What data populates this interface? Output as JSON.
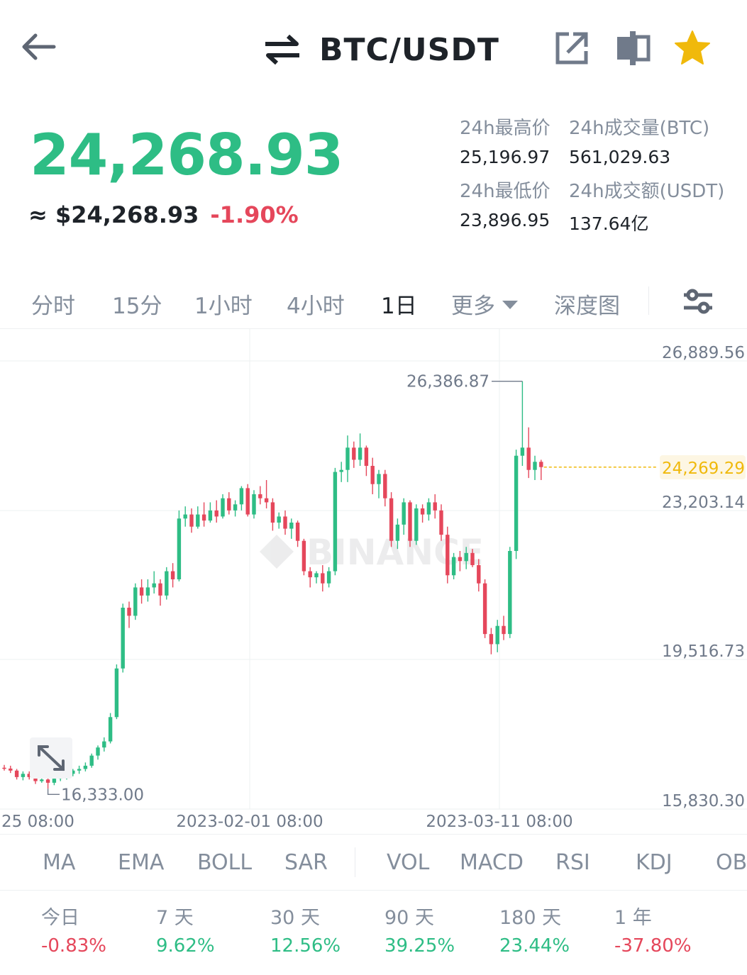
{
  "header": {
    "pair": "BTC/USDT",
    "icons": [
      "arrow-left-icon",
      "swap-icon",
      "external-link-icon",
      "compare-icon",
      "star-icon"
    ]
  },
  "price": {
    "last": "24,268.93",
    "usd": "≈ $24,268.93",
    "change": "-1.90%"
  },
  "stats": {
    "high_label": "24h最高价",
    "high_value": "25,196.97",
    "low_label": "24h最低价",
    "low_value": "23,896.95",
    "vol_label": "24h成交量(BTC)",
    "vol_value": "561,029.63",
    "turnover_label": "24h成交额(USDT)",
    "turnover_value": "137.64亿"
  },
  "timeframes": {
    "items": [
      "分时",
      "15分",
      "1小时",
      "4小时",
      "1日",
      "更多",
      "深度图"
    ],
    "active": "1日"
  },
  "chart": {
    "price_labels": [
      "26,889.56",
      "24,269.29",
      "23,203.14",
      "19,516.73",
      "15,830.30"
    ],
    "high_marker": "26,386.87",
    "low_marker": "16,333.00",
    "date_labels": [
      "25 08:00",
      "2023-02-01 08:00",
      "2023-03-11 08:00"
    ],
    "watermark": "BINANCE",
    "colors": {
      "up": "#2ebd85",
      "down": "#e5475b",
      "current": "#f0b90b"
    }
  },
  "chart_data": {
    "type": "candlestick",
    "x_start": "2022-12-25",
    "y_range": [
      15830.3,
      26889.56
    ],
    "current_price": 24269.29,
    "high": 26386.87,
    "low": 16333.0,
    "ohlc": [
      [
        16850,
        16920,
        16780,
        16830
      ],
      [
        16830,
        16900,
        16720,
        16780
      ],
      [
        16780,
        16820,
        16560,
        16620
      ],
      [
        16620,
        16760,
        16540,
        16700
      ],
      [
        16700,
        16760,
        16560,
        16620
      ],
      [
        16620,
        16680,
        16450,
        16520
      ],
      [
        16520,
        16620,
        16480,
        16560
      ],
      [
        16560,
        16650,
        16333,
        16480
      ],
      [
        16480,
        16620,
        16420,
        16580
      ],
      [
        16580,
        16680,
        16520,
        16620
      ],
      [
        16620,
        16760,
        16560,
        16700
      ],
      [
        16700,
        16820,
        16640,
        16780
      ],
      [
        16780,
        16900,
        16700,
        16820
      ],
      [
        16820,
        16980,
        16760,
        16900
      ],
      [
        16900,
        17200,
        16850,
        17150
      ],
      [
        17150,
        17400,
        17050,
        17350
      ],
      [
        17350,
        17600,
        17250,
        17500
      ],
      [
        17500,
        18200,
        17450,
        18100
      ],
      [
        18100,
        19400,
        18050,
        19300
      ],
      [
        19300,
        20900,
        19200,
        20800
      ],
      [
        20800,
        20950,
        20300,
        20600
      ],
      [
        20600,
        21400,
        20500,
        21300
      ],
      [
        21300,
        21500,
        20900,
        21100
      ],
      [
        21100,
        21500,
        20950,
        21300
      ],
      [
        21300,
        21700,
        21150,
        21400
      ],
      [
        21400,
        21500,
        20850,
        21100
      ],
      [
        21100,
        21800,
        21000,
        21700
      ],
      [
        21700,
        21900,
        21300,
        21500
      ],
      [
        21500,
        23200,
        21450,
        23000
      ],
      [
        23000,
        23300,
        22800,
        23100
      ],
      [
        23100,
        23250,
        22650,
        22800
      ],
      [
        22800,
        23300,
        22750,
        23100
      ],
      [
        23100,
        23400,
        22800,
        22950
      ],
      [
        22950,
        23400,
        22900,
        23200
      ],
      [
        23200,
        23450,
        22900,
        23050
      ],
      [
        23050,
        23600,
        23000,
        23500
      ],
      [
        23500,
        23650,
        23100,
        23200
      ],
      [
        23200,
        23450,
        23050,
        23350
      ],
      [
        23350,
        23800,
        23200,
        23750
      ],
      [
        23750,
        23850,
        23050,
        23100
      ],
      [
        23100,
        23700,
        23000,
        23600
      ],
      [
        23600,
        23800,
        23350,
        23500
      ],
      [
        23500,
        23950,
        23250,
        23400
      ],
      [
        23400,
        23500,
        22700,
        22900
      ],
      [
        22900,
        23150,
        22750,
        23050
      ],
      [
        23050,
        23200,
        22600,
        22750
      ],
      [
        22750,
        23000,
        22500,
        22900
      ],
      [
        22900,
        22950,
        22300,
        22450
      ],
      [
        22450,
        22500,
        21600,
        21700
      ],
      [
        21700,
        21800,
        21300,
        21550
      ],
      [
        21550,
        21700,
        21400,
        21650
      ],
      [
        21650,
        21850,
        21200,
        21400
      ],
      [
        21400,
        21800,
        21300,
        21700
      ],
      [
        21700,
        24250,
        21600,
        24150
      ],
      [
        24150,
        24400,
        23900,
        24200
      ],
      [
        24200,
        25050,
        23900,
        24750
      ],
      [
        24750,
        24900,
        24250,
        24450
      ],
      [
        24450,
        25100,
        24300,
        24750
      ],
      [
        24750,
        24800,
        24050,
        24300
      ],
      [
        24300,
        24500,
        23600,
        23850
      ],
      [
        23850,
        24200,
        23500,
        24100
      ],
      [
        24100,
        24200,
        23300,
        23500
      ],
      [
        23500,
        23650,
        22300,
        22450
      ],
      [
        22450,
        23000,
        22250,
        22850
      ],
      [
        22850,
        23500,
        22600,
        23400
      ],
      [
        23400,
        23450,
        22300,
        22450
      ],
      [
        22450,
        23350,
        22350,
        23250
      ],
      [
        23250,
        23350,
        22900,
        23100
      ],
      [
        23100,
        23500,
        22950,
        23400
      ],
      [
        23400,
        23600,
        23000,
        23200
      ],
      [
        23200,
        23350,
        22450,
        22600
      ],
      [
        22600,
        22800,
        21400,
        21600
      ],
      [
        21600,
        22150,
        21500,
        22050
      ],
      [
        22050,
        22200,
        21700,
        21950
      ],
      [
        21950,
        22300,
        21750,
        22150
      ],
      [
        22150,
        22250,
        21800,
        21850
      ],
      [
        21850,
        22000,
        21200,
        21400
      ],
      [
        21400,
        21500,
        20050,
        20150
      ],
      [
        20150,
        20300,
        19650,
        19900
      ],
      [
        19900,
        20500,
        19700,
        20350
      ],
      [
        20350,
        20600,
        20000,
        20150
      ],
      [
        20150,
        22300,
        20050,
        22200
      ],
      [
        22200,
        24700,
        22000,
        24550
      ],
      [
        24550,
        26386.87,
        24300,
        24750
      ],
      [
        24750,
        25250,
        24000,
        24200
      ],
      [
        24200,
        24550,
        23950,
        24400
      ],
      [
        24400,
        24450,
        23950,
        24269.29
      ]
    ]
  },
  "indicators": [
    "MA",
    "EMA",
    "BOLL",
    "SAR",
    "VOL",
    "MACD",
    "RSI",
    "KDJ",
    "OB"
  ],
  "performance": [
    {
      "label": "今日",
      "value": "-0.83%",
      "dir": "down"
    },
    {
      "label": "7 天",
      "value": "9.62%",
      "dir": "up"
    },
    {
      "label": "30 天",
      "value": "12.56%",
      "dir": "up"
    },
    {
      "label": "90 天",
      "value": "39.25%",
      "dir": "up"
    },
    {
      "label": "180 天",
      "value": "23.44%",
      "dir": "up"
    },
    {
      "label": "1 年",
      "value": "-37.80%",
      "dir": "down"
    }
  ]
}
